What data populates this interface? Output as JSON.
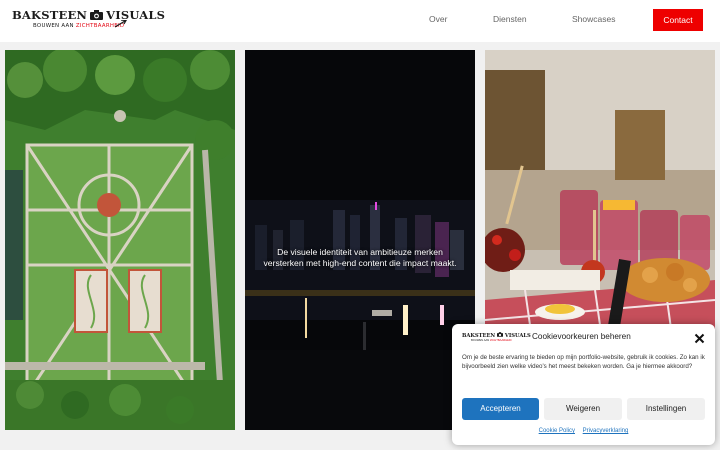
{
  "header": {
    "logo": {
      "main_left": "BAKSTEEN",
      "main_right": "VISUALS",
      "sub_plain": "BOUWEN AAN ",
      "sub_accent": "ZICHTBAARHEID"
    },
    "nav": [
      {
        "label": "Over"
      },
      {
        "label": "Diensten"
      },
      {
        "label": "Showcases"
      }
    ],
    "contact_label": "Contact",
    "accent_color": "#ee0000"
  },
  "gallery": {
    "tiles": [
      {
        "subject": "aerial-garden-photo"
      },
      {
        "subject": "night-city-skyline-photo",
        "overlay_text": "De visuele identiteit van ambitieuze merken versterken met high-end content die impact maakt."
      },
      {
        "subject": "catering-buffet-photo"
      }
    ]
  },
  "cookie_banner": {
    "logo": {
      "main_left": "BAKSTEEN",
      "main_right": "VISUALS",
      "sub_plain": "BOUWEN AAN ",
      "sub_accent": "ZICHTBAARHEID"
    },
    "title": "Cookievoorkeuren beheren",
    "body": "Om je de beste ervaring te bieden op mijn portfolio-website, gebruik ik cookies. Zo kan ik bijvoorbeeld zien welke video's het meest bekeken worden. Ga je hiermee akkoord?",
    "buttons": {
      "accept": "Accepteren",
      "deny": "Weigeren",
      "settings": "Instellingen"
    },
    "links": {
      "cookie_policy": "Cookie Policy",
      "privacy": "Privacyverklaring"
    },
    "accent_color": "#1e73be"
  }
}
